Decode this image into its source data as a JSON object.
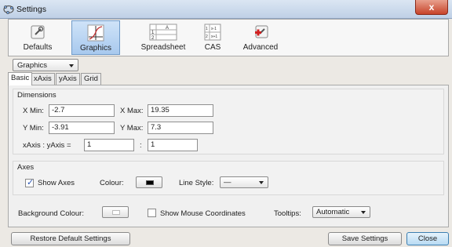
{
  "window": {
    "title": "Settings",
    "close_label": "x"
  },
  "toolbar": {
    "items": [
      {
        "label": "Defaults",
        "icon": "defaults-icon"
      },
      {
        "label": "Graphics",
        "icon": "graphics-icon",
        "active": true
      },
      {
        "label": "Spreadsheet",
        "icon": "spreadsheet-icon"
      },
      {
        "label": "CAS",
        "icon": "cas-icon"
      },
      {
        "label": "Advanced",
        "icon": "advanced-icon"
      }
    ]
  },
  "view_select": {
    "value": "Graphics"
  },
  "tabs": [
    {
      "label": "Basic",
      "active": true
    },
    {
      "label": "xAxis"
    },
    {
      "label": "yAxis"
    },
    {
      "label": "Grid"
    }
  ],
  "dimensions": {
    "title": "Dimensions",
    "xmin_label": "X Min:",
    "xmin_value": "-2.7",
    "xmax_label": "X Max:",
    "xmax_value": "19.35",
    "ymin_label": "Y Min:",
    "ymin_value": "-3.91",
    "ymax_label": "Y Max:",
    "ymax_value": "7.3",
    "ratio_label": "xAxis : yAxis =",
    "ratio_x": "1",
    "ratio_sep": ":",
    "ratio_y": "1"
  },
  "axes": {
    "title": "Axes",
    "show_axes_label": "Show Axes",
    "show_axes_checked": true,
    "colour_label": "Colour:",
    "colour_value": "#000000",
    "line_style_label": "Line Style:",
    "line_style_value": "—"
  },
  "misc": {
    "background_label": "Background Colour:",
    "background_value": "#ffffff",
    "show_mouse_label": "Show Mouse Coordinates",
    "show_mouse_checked": false,
    "tooltips_label": "Tooltips:",
    "tooltips_value": "Automatic"
  },
  "buttons": {
    "restore": "Restore Default Settings",
    "save": "Save Settings",
    "close": "Close"
  }
}
